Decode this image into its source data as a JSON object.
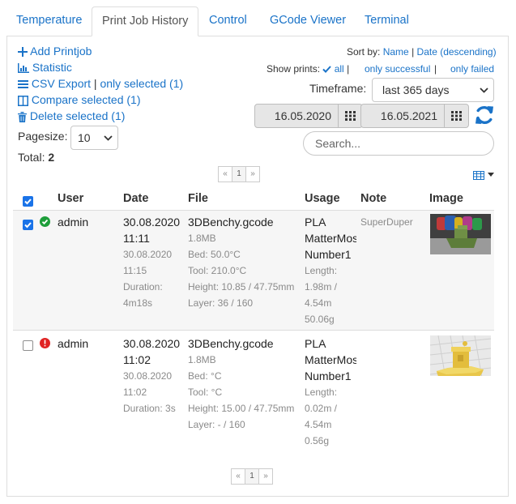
{
  "tabs": [
    {
      "label": "Temperature"
    },
    {
      "label": "Print Job History"
    },
    {
      "label": "Control"
    },
    {
      "label": "GCode Viewer"
    },
    {
      "label": "Terminal"
    }
  ],
  "actions": {
    "add": "Add Printjob",
    "statistic": "Statistic",
    "csv_export": "CSV Export",
    "only_selected": "only selected (1)",
    "compare": "Compare selected (1)",
    "delete": "Delete selected (1)"
  },
  "pagesize": {
    "label": "Pagesize:",
    "value": "10"
  },
  "total": {
    "label": "Total:",
    "value": "2"
  },
  "sort": {
    "label": "Sort by:",
    "name": "Name",
    "date": "Date (descending)"
  },
  "show": {
    "label": "Show prints:",
    "all": "all",
    "successful": "only successful",
    "failed": "only failed",
    "sep": "|"
  },
  "timeframe": {
    "label": "Timeframe:",
    "value": "last 365 days"
  },
  "dates": {
    "from": "16.05.2020",
    "to": "16.05.2021"
  },
  "search": {
    "placeholder": "Search..."
  },
  "pager": {
    "prev": "«",
    "page": "1",
    "next": "»"
  },
  "columns": {
    "user": "User",
    "date": "Date",
    "file": "File",
    "usage": "Usage",
    "note": "Note",
    "image": "Image"
  },
  "jobs": [
    {
      "selected": true,
      "status": "success",
      "user": "admin",
      "date_start": "30.08.2020",
      "time_start": "11:11",
      "date_end": "30.08.2020",
      "time_end": "11:15",
      "duration": "Duration:",
      "duration_value": "4m18s",
      "file": "3DBenchy.gcode",
      "size": "1.8MB",
      "bed": "Bed: 50.0°C",
      "tool": "Tool: 210.0°C",
      "height": "Height: 10.85 / 47.75mm",
      "layer": "Layer: 36 / 160",
      "material": "PLA",
      "vendor": "MatterMos",
      "spool": "Number1",
      "length_label": "Length:",
      "length": "1.98m /",
      "length_total": "4.54m",
      "weight": "50.06g",
      "note": "SuperDuper"
    },
    {
      "selected": false,
      "status": "failed",
      "user": "admin",
      "date_start": "30.08.2020",
      "time_start": "11:02",
      "date_end": "30.08.2020",
      "time_end": "11:02",
      "duration": "Duration: 3s",
      "file": "3DBenchy.gcode",
      "size": "1.8MB",
      "bed": "Bed: °C",
      "tool": "Tool: °C",
      "height": "Height: 15.00 / 47.75mm",
      "layer": "Layer: - / 160",
      "material": "PLA",
      "vendor": "MatterMos",
      "spool": "Number1",
      "length_label": "Length:",
      "length": "0.02m /",
      "length_total": "4.54m",
      "weight": "0.56g",
      "note": ""
    }
  ],
  "colors": {
    "link": "#1a73c8",
    "success": "#1e9e3a",
    "error": "#e02424",
    "checkbox": "#1a73e8"
  },
  "icons": [
    "plus-icon",
    "bar-chart-icon",
    "list-icon",
    "columns-icon",
    "trash-icon",
    "check-icon",
    "calendar-icon",
    "refresh-icon",
    "table-icon",
    "caret-down-icon",
    "success-icon",
    "error-icon"
  ]
}
